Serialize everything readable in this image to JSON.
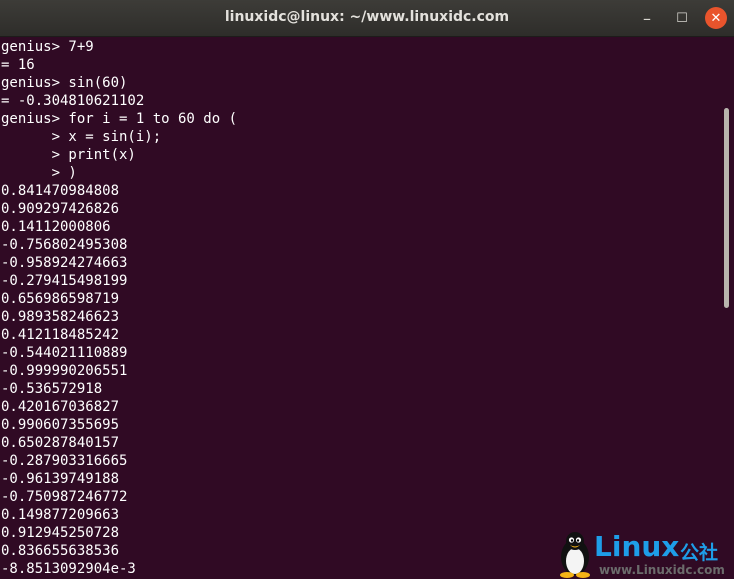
{
  "window": {
    "title": "linuxidc@linux: ~/www.linuxidc.com",
    "minimize_symbol": "–",
    "maximize_symbol": "☐",
    "close_symbol": "✕"
  },
  "terminal": {
    "lines": [
      "genius> 7+9",
      "= 16",
      "genius> sin(60)",
      "= -0.304810621102",
      "genius> for i = 1 to 60 do (",
      "      > x = sin(i);",
      "      > print(x)",
      "      > )",
      "0.841470984808",
      "0.909297426826",
      "0.14112000806",
      "-0.756802495308",
      "-0.958924274663",
      "-0.279415498199",
      "0.656986598719",
      "0.989358246623",
      "0.412118485242",
      "-0.544021110889",
      "-0.999990206551",
      "-0.536572918",
      "0.420167036827",
      "0.990607355695",
      "0.650287840157",
      "-0.287903316665",
      "-0.96139749188",
      "-0.750987246772",
      "0.149877209663",
      "0.912945250728",
      "0.836655638536",
      "-8.8513092904e-3"
    ]
  },
  "watermark": {
    "brand": "Linux",
    "cn": "公社",
    "url": "www.Linuxidc.com",
    "icon": "tux-penguin-icon"
  },
  "colors": {
    "terminal_bg": "#300a24",
    "text": "#ffffff",
    "close_button": "#e9542c",
    "brand_blue": "#1e9ee8"
  }
}
